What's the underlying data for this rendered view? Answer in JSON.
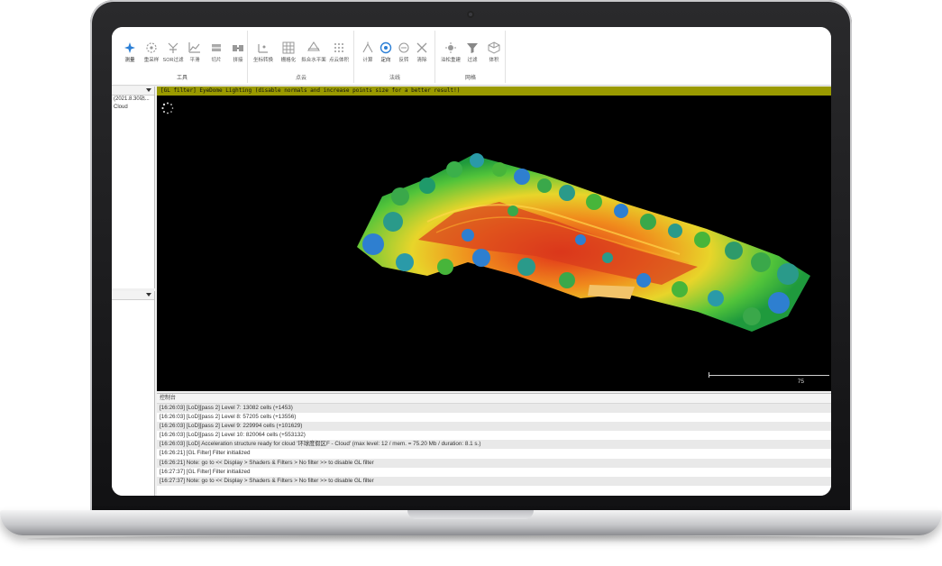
{
  "ribbon": {
    "groups": [
      {
        "label": "工具",
        "tools": [
          {
            "label": "测量",
            "icon": "measure-icon"
          },
          {
            "label": "重采样",
            "icon": "resample-icon"
          },
          {
            "label": "SOR过滤",
            "icon": "sor-filter-icon"
          },
          {
            "label": "平滑",
            "icon": "smooth-icon"
          },
          {
            "label": "切片",
            "icon": "slice-icon"
          },
          {
            "label": "拼接",
            "icon": "merge-icon"
          }
        ]
      },
      {
        "label": "点云",
        "tools": [
          {
            "label": "坐标转换",
            "icon": "coordinate-transform-icon"
          },
          {
            "label": "栅格化",
            "icon": "rasterize-icon"
          },
          {
            "label": "拟合水平面",
            "icon": "fit-plane-icon"
          },
          {
            "label": "点云体积",
            "icon": "cloud-volume-icon"
          }
        ]
      },
      {
        "label": "法线",
        "tools": [
          {
            "label": "计算",
            "icon": "compute-icon"
          },
          {
            "label": "定向",
            "icon": "orient-icon"
          },
          {
            "label": "反转",
            "icon": "invert-icon"
          },
          {
            "label": "清除",
            "icon": "clear-icon"
          }
        ]
      },
      {
        "label": "网格",
        "tools": [
          {
            "label": "泊松重建",
            "icon": "poisson-icon"
          },
          {
            "label": "过滤",
            "icon": "filter-icon"
          },
          {
            "label": "体积",
            "icon": "volume-icon"
          }
        ]
      }
    ]
  },
  "tree": {
    "item1": "(2021.8.30站...",
    "item2": "Cloud"
  },
  "view": {
    "banner": "[GL filter] EyeDome Lighting (disable normals and increase points size for a better result!)",
    "scale_label": "75"
  },
  "console": {
    "title": "控制台",
    "lines": [
      "[16:26:03] [LoD][pass 2] Level 7: 13082 cells (+1453)",
      "[16:26:03] [LoD][pass 2] Level 8: 57205 cells (+13556)",
      "[16:26:03] [LoD][pass 2] Level 9: 229994 cells (+101629)",
      "[16:26:03] [LoD][pass 2] Level 10: 820064 cells (+553132)",
      "[16:26:03] [LoD] Acceleration structure ready for cloud '环球度假区F - Cloud' (max level: 12 / mem. = 75.20 Mb / duration: 8.1 s.)",
      "[16:26:21] [GL Filter] Filter initialized",
      "[16:26:21] Note: go to << Display > Shaders & Filters > No filter >> to disable GL filter",
      "[16:27:37] [GL Filter] Filter initialized",
      "[16:27:37] Note: go to << Display > Shaders & Filters > No filter >> to disable GL filter"
    ]
  },
  "colors": {
    "accent": "#2b7fd6",
    "banner": "#9a9a00"
  }
}
